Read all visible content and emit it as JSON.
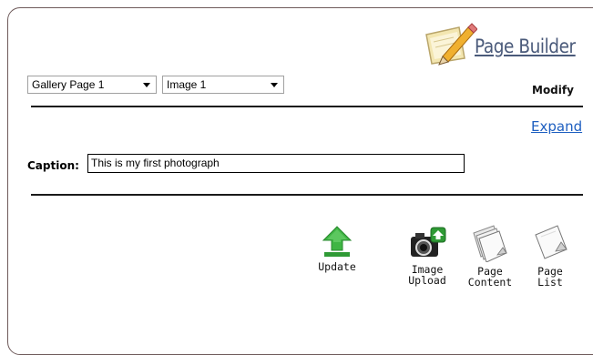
{
  "header": {
    "logo_text": "Page Builder",
    "mode_label": "Modify"
  },
  "selectors": {
    "page": "Gallery Page 1",
    "image": "Image 1"
  },
  "links": {
    "expand": "Expand"
  },
  "caption": {
    "label": "Caption:",
    "value": "This is my first photograph"
  },
  "toolbar": {
    "update": "Update",
    "image_upload_line1": "Image",
    "image_upload_line2": "Upload",
    "page_content_line1": "Page",
    "page_content_line2": "Content",
    "page_list_line1": "Page",
    "page_list_line2": "List"
  },
  "icons": {
    "logo": "pencil-paper-icon",
    "update": "upload-arrow-icon",
    "image_upload": "camera-upload-icon",
    "page_content": "stacked-pages-icon",
    "page_list": "page-icon"
  },
  "colors": {
    "accent_green": "#35a83a",
    "link_blue": "#1e5fc0",
    "logo_text": "#4a5a7a"
  }
}
